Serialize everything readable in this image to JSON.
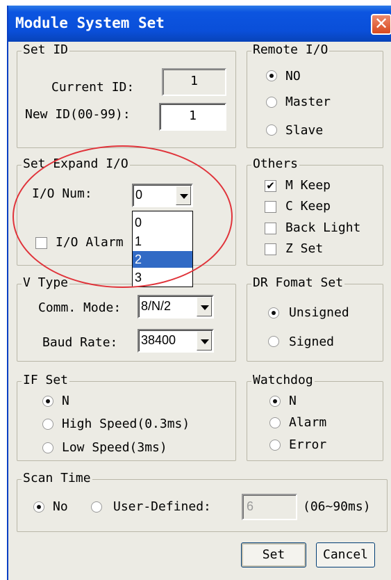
{
  "window": {
    "title": "Module System Set",
    "close_glyph": "✕"
  },
  "set_id": {
    "legend": "Set ID",
    "current_label": "Current ID:",
    "current_value": "1",
    "new_label": "New ID(00-99):",
    "new_value": "1"
  },
  "remote_io": {
    "legend": "Remote I/O",
    "options": [
      {
        "label": "NO",
        "selected": true
      },
      {
        "label": "Master",
        "selected": false
      },
      {
        "label": "Slave",
        "selected": false
      }
    ]
  },
  "set_expand_io": {
    "legend": "Set Expand I/O",
    "io_num_label": "I/O Num:",
    "io_num_value": "0",
    "io_num_options": [
      "0",
      "1",
      "2",
      "3"
    ],
    "io_num_highlighted": "2",
    "alarm_label": "I/O Alarm",
    "alarm_checked": false
  },
  "others": {
    "legend": "Others",
    "items": [
      {
        "label": "M Keep",
        "checked": true
      },
      {
        "label": "C Keep",
        "checked": false
      },
      {
        "label": "Back Light",
        "checked": false
      },
      {
        "label": "Z Set",
        "checked": false
      }
    ],
    "check_glyph": "✔"
  },
  "v_type": {
    "legend": "V Type",
    "comm_label": "Comm. Mode:",
    "comm_value": "8/N/2",
    "baud_label": "Baud Rate:",
    "baud_value": "38400"
  },
  "dr_format": {
    "legend": "DR Fomat Set",
    "options": [
      {
        "label": "Unsigned",
        "selected": true
      },
      {
        "label": "Signed",
        "selected": false
      }
    ]
  },
  "if_set": {
    "legend": "IF Set",
    "options": [
      {
        "label": "N",
        "selected": true
      },
      {
        "label": "High Speed(0.3ms)",
        "selected": false
      },
      {
        "label": "Low Speed(3ms)",
        "selected": false
      }
    ]
  },
  "watchdog": {
    "legend": "Watchdog",
    "options": [
      {
        "label": "N",
        "selected": true
      },
      {
        "label": "Alarm",
        "selected": false
      },
      {
        "label": "Error",
        "selected": false
      }
    ]
  },
  "scan_time": {
    "legend": "Scan Time",
    "no_label": "No",
    "no_selected": true,
    "user_label": "User-Defined:",
    "user_selected": false,
    "user_value": "6",
    "range_label": "(06~90ms)"
  },
  "buttons": {
    "set": "Set",
    "cancel": "Cancel"
  },
  "annotation": {
    "color": "#e0333a",
    "shape": "ellipse"
  },
  "colors": {
    "titlebar": "#0a4fd9",
    "dialog_bg": "#ecebe4",
    "selection": "#316ac5"
  }
}
